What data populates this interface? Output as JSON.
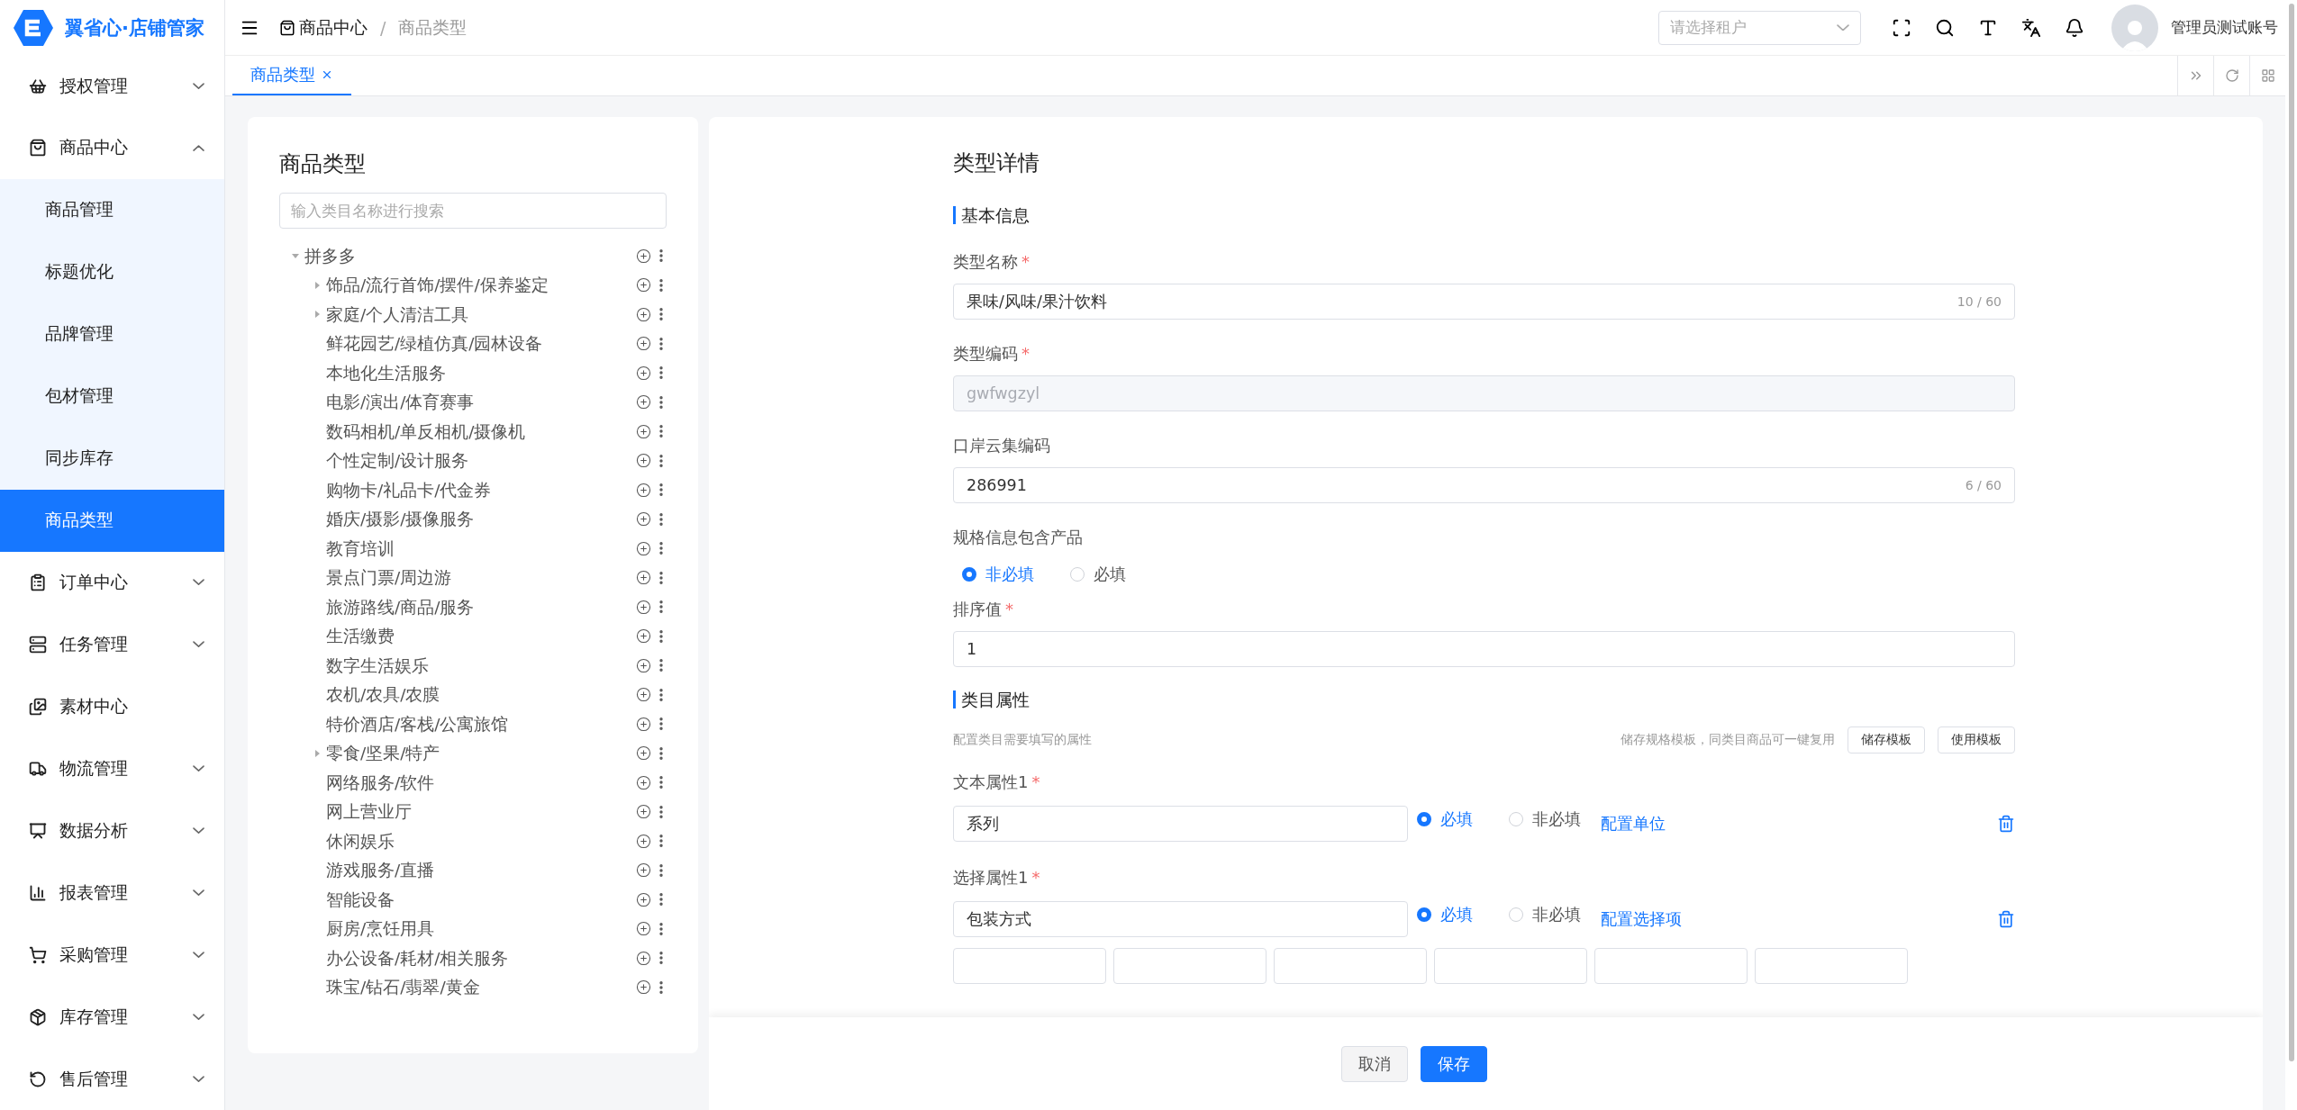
{
  "brand": {
    "name": "翼省心·店铺管家"
  },
  "sidebar": {
    "items": [
      {
        "label": "授权管理",
        "kind": "group",
        "expanded": false
      },
      {
        "label": "商品中心",
        "kind": "group",
        "expanded": true,
        "children": [
          {
            "label": "商品管理",
            "selected": false
          },
          {
            "label": "标题优化",
            "selected": false
          },
          {
            "label": "品牌管理",
            "selected": false
          },
          {
            "label": "包材管理",
            "selected": false
          },
          {
            "label": "同步库存",
            "selected": false
          },
          {
            "label": "商品类型",
            "selected": true
          }
        ]
      },
      {
        "label": "订单中心",
        "kind": "group",
        "expanded": false
      },
      {
        "label": "任务管理",
        "kind": "group",
        "expanded": false
      },
      {
        "label": "素材中心",
        "kind": "link"
      },
      {
        "label": "物流管理",
        "kind": "group",
        "expanded": false
      },
      {
        "label": "数据分析",
        "kind": "group",
        "expanded": false
      },
      {
        "label": "报表管理",
        "kind": "group",
        "expanded": false
      },
      {
        "label": "采购管理",
        "kind": "group",
        "expanded": false
      },
      {
        "label": "库存管理",
        "kind": "group",
        "expanded": false
      },
      {
        "label": "售后管理",
        "kind": "group",
        "expanded": false
      }
    ]
  },
  "header": {
    "breadcrumb": [
      "商品中心",
      "商品类型"
    ],
    "breadcrumb_separator": "/",
    "tenant_select": {
      "placeholder": "请选择租户"
    },
    "user": "管理员测试账号"
  },
  "tabs": [
    {
      "label": "商品类型",
      "selected": true
    }
  ],
  "tree_panel": {
    "title": "商品类型",
    "search": {
      "placeholder": "输入类目名称进行搜索"
    },
    "nodes": [
      {
        "label": "拼多多",
        "kind": "folder",
        "expanded": true,
        "children": [
          {
            "label": "饰品/流行首饰/摆件/保养鉴定",
            "kind": "folder",
            "expanded": false
          },
          {
            "label": "家庭/个人清洁工具",
            "kind": "folder",
            "expanded": false
          },
          {
            "label": "鲜花园艺/绿植仿真/园林设备",
            "kind": "leaf"
          },
          {
            "label": "本地化生活服务",
            "kind": "leaf"
          },
          {
            "label": "电影/演出/体育赛事",
            "kind": "leaf"
          },
          {
            "label": "数码相机/单反相机/摄像机",
            "kind": "leaf"
          },
          {
            "label": "个性定制/设计服务",
            "kind": "leaf"
          },
          {
            "label": "购物卡/礼品卡/代金券",
            "kind": "leaf"
          },
          {
            "label": "婚庆/摄影/摄像服务",
            "kind": "leaf"
          },
          {
            "label": "教育培训",
            "kind": "leaf"
          },
          {
            "label": "景点门票/周边游",
            "kind": "leaf"
          },
          {
            "label": "旅游路线/商品/服务",
            "kind": "leaf"
          },
          {
            "label": "生活缴费",
            "kind": "leaf"
          },
          {
            "label": "数字生活娱乐",
            "kind": "leaf"
          },
          {
            "label": "农机/农具/农膜",
            "kind": "leaf"
          },
          {
            "label": "特价酒店/客栈/公寓旅馆",
            "kind": "leaf"
          },
          {
            "label": "零食/坚果/特产",
            "kind": "folder",
            "expanded": false
          },
          {
            "label": "网络服务/软件",
            "kind": "leaf"
          },
          {
            "label": "网上营业厅",
            "kind": "leaf"
          },
          {
            "label": "休闲娱乐",
            "kind": "leaf"
          },
          {
            "label": "游戏服务/直播",
            "kind": "leaf"
          },
          {
            "label": "智能设备",
            "kind": "leaf"
          },
          {
            "label": "厨房/烹饪用具",
            "kind": "leaf"
          },
          {
            "label": "办公设备/耗材/相关服务",
            "kind": "leaf"
          },
          {
            "label": "珠宝/钻石/翡翠/黄金",
            "kind": "leaf"
          }
        ]
      }
    ]
  },
  "detail": {
    "title": "类型详情",
    "required_mark": "*",
    "basic": {
      "heading": "基本信息",
      "fields": [
        {
          "kind": "text",
          "label": "类型名称",
          "required": true,
          "disabled": false,
          "value": "果味/风味/果汁饮料",
          "count": "10 / 60"
        },
        {
          "kind": "text",
          "label": "类型编码",
          "required": true,
          "disabled": true,
          "value": "gwfwgzyl"
        },
        {
          "kind": "text",
          "label": "口岸云集编码",
          "required": false,
          "disabled": false,
          "value": "286991",
          "count": "6 / 60"
        },
        {
          "kind": "radio",
          "label": "规格信息包含产品",
          "options": [
            {
              "label": "非必填",
              "selected": true
            },
            {
              "label": "必填",
              "selected": false
            }
          ]
        },
        {
          "kind": "text",
          "label": "排序值",
          "required": true,
          "disabled": false,
          "value": "1"
        }
      ]
    },
    "attributes": {
      "heading": "类目属性",
      "hint": "配置类目需要填写的属性",
      "template_hint": "储存规格模板，同类目商品可一键复用",
      "buttons": [
        "储存模板",
        "使用模板"
      ],
      "items": [
        {
          "kind": "text",
          "label": "文本属性1",
          "required": true,
          "value": "系列",
          "options": [
            {
              "label": "必填",
              "selected": true
            },
            {
              "label": "非必填",
              "selected": false
            }
          ],
          "link": "配置单位"
        },
        {
          "kind": "select",
          "label": "选择属性1",
          "required": true,
          "value": "包装方式",
          "options": [
            {
              "label": "必填",
              "selected": true
            },
            {
              "label": "非必填",
              "selected": false
            }
          ],
          "link": "配置选择项"
        }
      ]
    }
  },
  "footer": {
    "buttons": [
      {
        "label": "取消",
        "kind": "secondary"
      },
      {
        "label": "保存",
        "kind": "primary"
      }
    ]
  }
}
